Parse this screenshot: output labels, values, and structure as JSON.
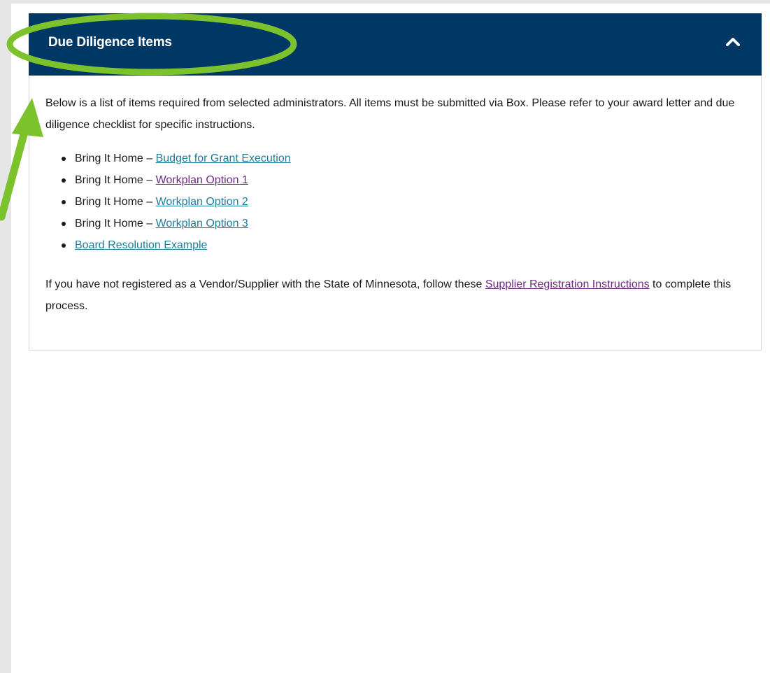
{
  "accordion": {
    "title": "Due Diligence Items",
    "toggle_icon": "chevron-up-icon",
    "expanded": true
  },
  "body": {
    "intro": "Below is a list of items required from selected administrators. All items must be submitted via Box. Please refer to your award letter and due diligence checklist for specific instructions.",
    "items": [
      {
        "prefix": "Bring It Home – ",
        "link_text": "Budget for Grant Execution",
        "visited": false
      },
      {
        "prefix": "Bring It Home – ",
        "link_text": "Workplan Option 1",
        "visited": true
      },
      {
        "prefix": "Bring It Home – ",
        "link_text": "Workplan Option 2",
        "visited": false
      },
      {
        "prefix": "Bring It Home – ",
        "link_text": "Workplan Option 3",
        "visited": false
      },
      {
        "prefix": "",
        "link_text": "Board Resolution Example",
        "visited": false
      }
    ],
    "outro_before": "If you have not registered as a Vendor/Supplier with the State of Minnesota, follow these ",
    "outro_link": "Supplier Registration Instructions",
    "outro_after": " to complete this process."
  },
  "colors": {
    "header_bg": "#003865",
    "header_text": "#ffffff",
    "link": "#1f7d9a",
    "link_visited": "#6b2d7a",
    "annotation": "#7cc22c"
  },
  "annotation": {
    "shape": "ellipse-and-arrow",
    "highlights": "accordion-title"
  }
}
